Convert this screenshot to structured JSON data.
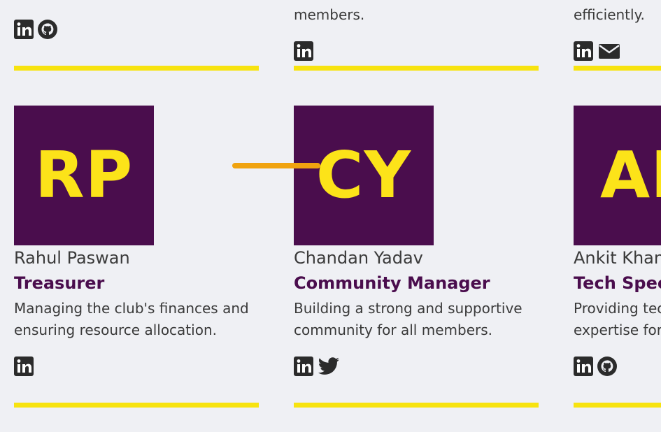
{
  "colors": {
    "background": "#eff0f4",
    "avatar_bg": "#4a0d4d",
    "accent_yellow": "#f7e30f",
    "role_color": "#4a0d4d",
    "connector": "#f0a30f"
  },
  "top_row": {
    "col2_desc_tail": "members.",
    "col3_desc_tail": "efficiently."
  },
  "members": [
    {
      "initials": "RP",
      "name": "Rahul Paswan",
      "role": "Treasurer",
      "desc_line1": "Managing the club's finances and",
      "desc_line2": "ensuring resource allocation.",
      "icons": [
        "linkedin-icon"
      ]
    },
    {
      "initials": "CY",
      "name": "Chandan Yadav",
      "role": "Community Manager",
      "desc_line1": "Building a strong and supportive",
      "desc_line2": "community for all members.",
      "icons": [
        "linkedin-icon",
        "twitter-icon"
      ]
    },
    {
      "initials": "AK",
      "name": "Ankit Khan",
      "role": "Tech Spec",
      "desc_line1": "Providing tec",
      "desc_line2": "expertise for",
      "icons": [
        "linkedin-icon",
        "github-icon"
      ]
    }
  ]
}
